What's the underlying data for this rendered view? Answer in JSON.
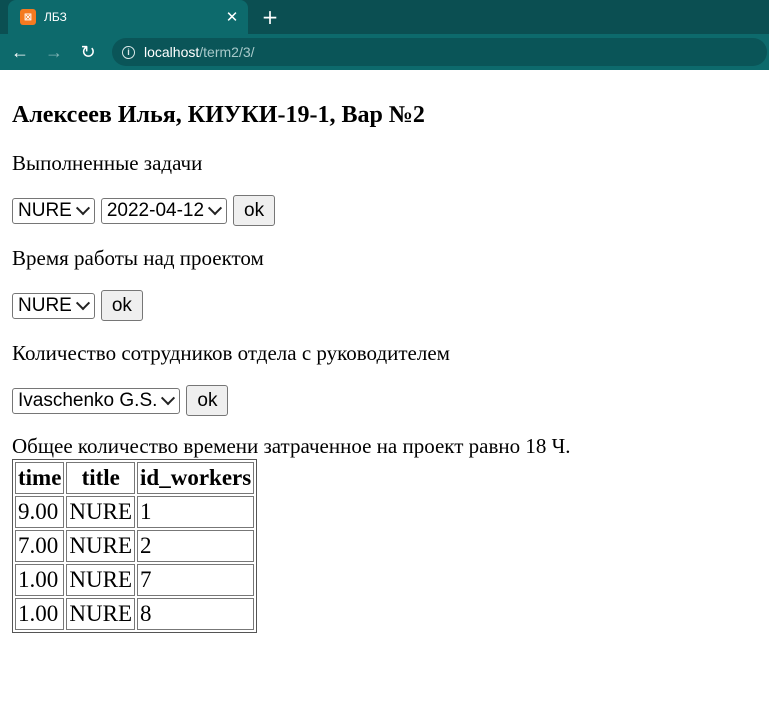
{
  "browser": {
    "tab_title": "ЛБЗ",
    "favicon_glyph": "⊠",
    "close_glyph": "✕",
    "new_tab_glyph": "+",
    "url_host": "localhost",
    "url_path": "/term2/3/",
    "back_glyph": "←",
    "forward_glyph": "→",
    "reload_glyph": "↻"
  },
  "page": {
    "heading": "Алексеев Илья, КИУКИ-19-1, Вар №2",
    "section1": {
      "label": "Выполненные задачи",
      "project_select": "NURE",
      "date_select": "2022-04-12",
      "ok": "ok"
    },
    "section2": {
      "label": "Время работы над проектом",
      "project_select": "NURE",
      "ok": "ok"
    },
    "section3": {
      "label": "Количество сотрудников отдела с руководителем",
      "manager_select": "Ivaschenko G.S.",
      "ok": "ok"
    },
    "summary": "Общее количество времени затраченное на проект равно 18 Ч.",
    "table": {
      "headers": [
        "time",
        "title",
        "id_workers"
      ],
      "rows": [
        [
          "9.00",
          "NURE",
          "1"
        ],
        [
          "7.00",
          "NURE",
          "2"
        ],
        [
          "1.00",
          "NURE",
          "7"
        ],
        [
          "1.00",
          "NURE",
          "8"
        ]
      ]
    }
  },
  "colors": {
    "tabbar": "#0b4f52",
    "toolbar": "#0d6a6c",
    "favicon": "#f47a20"
  }
}
